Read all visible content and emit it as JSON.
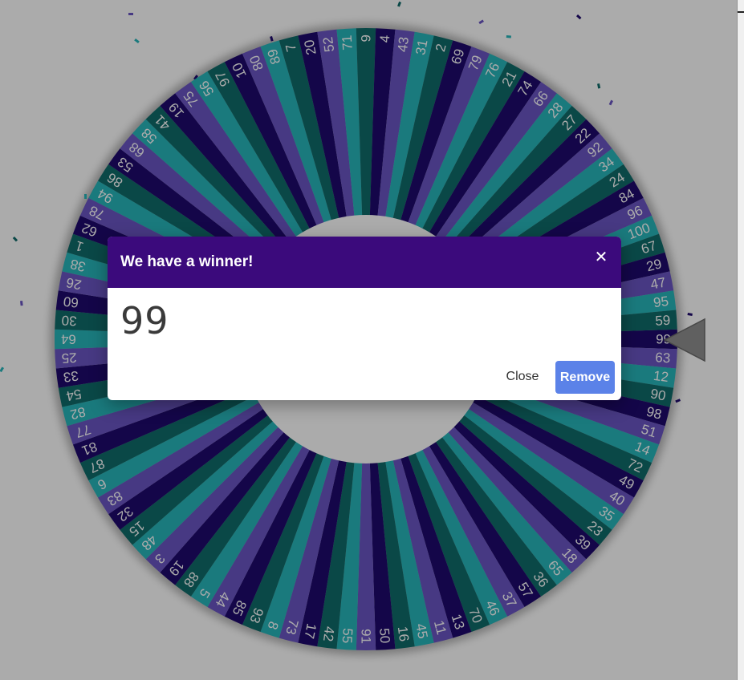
{
  "modal": {
    "title": "We have a winner!",
    "close_icon_glyph": "✕",
    "winner_value": "99",
    "close_label": "Close",
    "remove_label": "Remove"
  },
  "wheel": {
    "pointer_icon": "triangle-pointer-icon",
    "segment_colors": [
      "#1f0a6e",
      "#6b55c4",
      "#27b6bb",
      "#0f6c6a"
    ],
    "labels": [
      "99",
      "63",
      "12",
      "90",
      "98",
      "51",
      "14",
      "72",
      "49",
      "40",
      "35",
      "23",
      "39",
      "18",
      "65",
      "36",
      "57",
      "37",
      "46",
      "70",
      "13",
      "11",
      "45",
      "16",
      "50",
      "91",
      "55",
      "42",
      "17",
      "73",
      "8",
      "93",
      "85",
      "44",
      "5",
      "88",
      "19",
      "3",
      "48",
      "15",
      "32",
      "83",
      "6",
      "87",
      "81",
      "77",
      "82",
      "54",
      "33",
      "25",
      "64",
      "30",
      "60",
      "26",
      "38",
      "1",
      "62",
      "78",
      "94",
      "86",
      "53",
      "68",
      "58",
      "41",
      "19",
      "75",
      "56",
      "97",
      "10",
      "80",
      "89",
      "7",
      "20",
      "52",
      "71",
      "9",
      "4",
      "43",
      "31",
      "2",
      "69",
      "79",
      "76",
      "21",
      "74",
      "66",
      "28",
      "27",
      "22",
      "92",
      "34",
      "24",
      "84",
      "96",
      "100",
      "67",
      "29",
      "47",
      "95",
      "59"
    ]
  }
}
